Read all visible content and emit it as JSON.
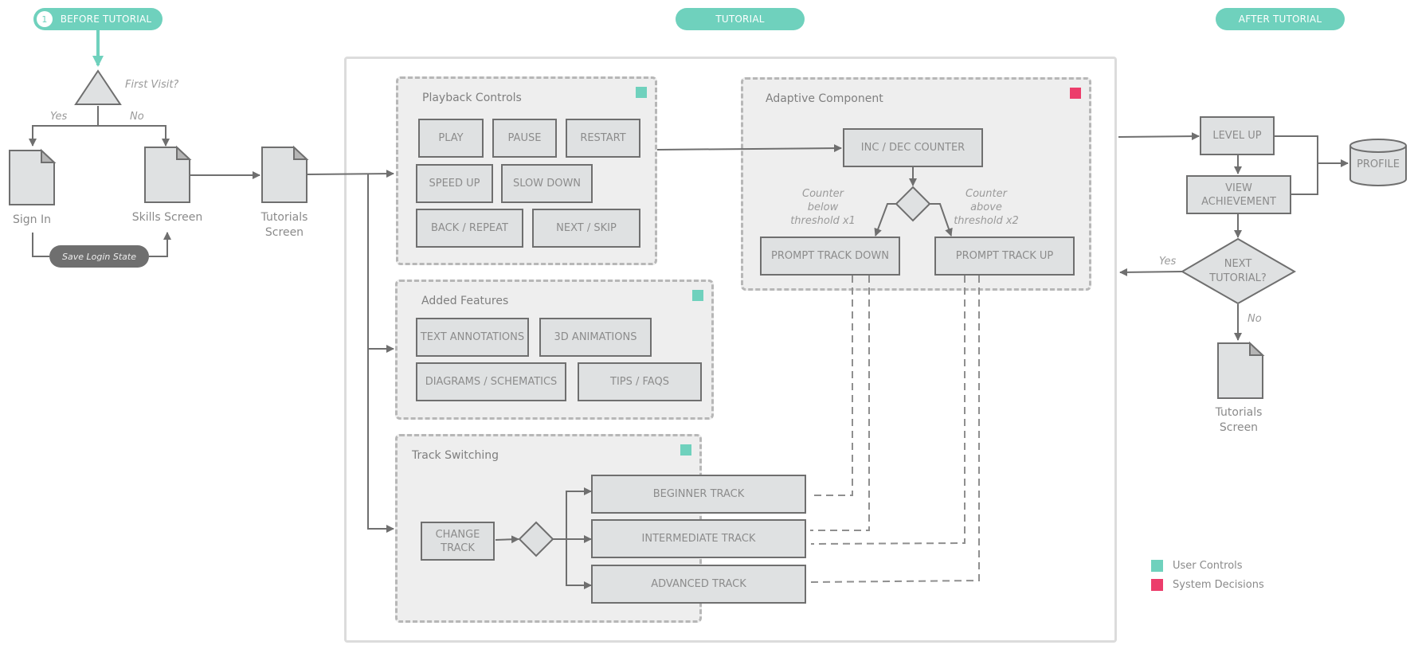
{
  "phases": {
    "before": {
      "number": "1",
      "label": "BEFORE TUTORIAL"
    },
    "tutorial": {
      "label": "TUTORIAL"
    },
    "after": {
      "label": "AFTER TUTORIAL"
    }
  },
  "colors": {
    "user_controls": "#6fd1bd",
    "system_decisions": "#ec3d6b",
    "phase_pill": "#6fd1bd"
  },
  "before": {
    "decision": "First Visit?",
    "yes": "Yes",
    "no": "No",
    "sign_in": "Sign In",
    "skills_screen": "Skills Screen",
    "tutorials_screen": "Tutorials Screen",
    "save_login_state": "Save Login State"
  },
  "playback": {
    "title": "Playback Controls",
    "buttons": [
      "PLAY",
      "PAUSE",
      "RESTART",
      "SPEED UP",
      "SLOW DOWN",
      "BACK / REPEAT",
      "NEXT / SKIP"
    ]
  },
  "added": {
    "title": "Added Features",
    "items": [
      "TEXT ANNOTATIONS",
      "3D ANIMATIONS",
      "DIAGRAMS / SCHEMATICS",
      "TIPS / FAQS"
    ]
  },
  "track": {
    "title": "Track Switching",
    "change": "CHANGE TRACK",
    "tracks": [
      "BEGINNER TRACK",
      "INTERMEDIATE TRACK",
      "ADVANCED TRACK"
    ]
  },
  "adaptive": {
    "title": "Adaptive Component",
    "counter": "INC / DEC COUNTER",
    "below": "Counter below threshold x1",
    "above": "Counter above threshold x2",
    "down": "PROMPT TRACK DOWN",
    "up": "PROMPT TRACK UP"
  },
  "after": {
    "level_up": "LEVEL UP",
    "view_achievement": "VIEW ACHIEVEMENT",
    "profile": "PROFILE",
    "next_tutorial": "NEXT TUTORIAL?",
    "yes": "Yes",
    "no": "No",
    "tutorials_screen": "Tutorials Screen"
  },
  "legend": [
    {
      "label": "User Controls",
      "color": "#6fd1bd"
    },
    {
      "label": "System Decisions",
      "color": "#ec3d6b"
    }
  ]
}
